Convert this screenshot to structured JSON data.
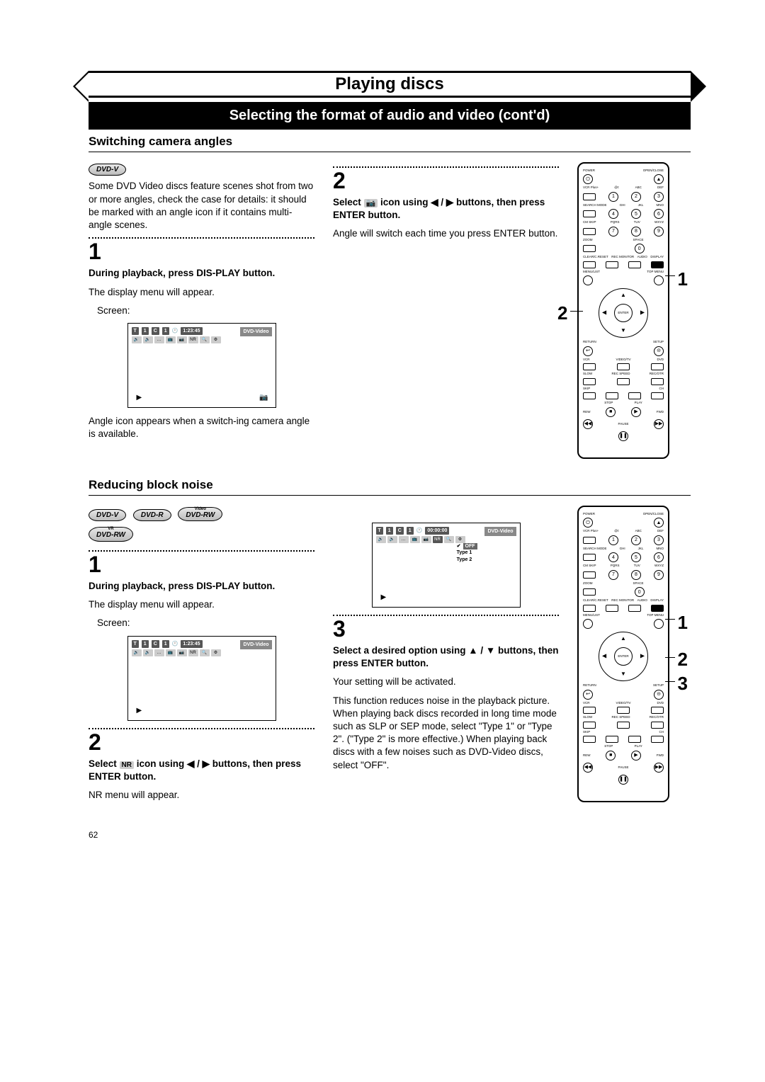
{
  "header": {
    "title": "Playing discs"
  },
  "banner": "Selecting the format of audio and video (cont'd)",
  "section1": {
    "heading": "Switching camera angles",
    "logos": [
      "DVD-V"
    ],
    "intro": "Some DVD Video discs feature scenes shot from two or more angles, check the case for details: it should be marked with an angle icon if it contains multi-angle scenes.",
    "step1": {
      "num": "1",
      "bold": "During playback, press DIS-PLAY button.",
      "text": "The display menu will appear.",
      "screen_label": "Screen:",
      "screen": {
        "t": "T",
        "tval": "1",
        "c": "C",
        "cval": "1",
        "time": "1:23:45",
        "label": "DVD-Video"
      },
      "caption": "Angle icon appears when a switch-ing camera angle is available."
    },
    "step2": {
      "num": "2",
      "bold_pre": "Select ",
      "icon": "📷",
      "bold_post": " icon using ◀ / ▶ buttons, then press ENTER button.",
      "text": "Angle will switch each time you press ENTER button."
    },
    "callouts": [
      "1",
      "2"
    ]
  },
  "section2": {
    "heading": "Reducing block noise",
    "logos": [
      "DVD-V",
      "DVD-R",
      "DVD-RW",
      "DVD-RW"
    ],
    "logos_sub": [
      "",
      "",
      "Video",
      "VR"
    ],
    "step1": {
      "num": "1",
      "bold": "During playback, press DIS-PLAY button.",
      "text": "The display menu will appear.",
      "screen_label": "Screen:",
      "screen": {
        "t": "T",
        "tval": "1",
        "c": "C",
        "cval": "1",
        "time": "1:23:45",
        "label": "DVD-Video"
      }
    },
    "step2": {
      "num": "2",
      "bold_pre": "Select ",
      "icon": "NR",
      "bold_post": " icon using ◀ / ▶ buttons, then press ENTER button.",
      "text": "NR menu will appear.",
      "screen": {
        "t": "T",
        "tval": "1",
        "c": "C",
        "cval": "1",
        "time": "00:00:00",
        "label": "DVD-Video",
        "menu": {
          "off": "OFF",
          "check": "✔",
          "t1": "Type 1",
          "t2": "Type 2"
        }
      }
    },
    "step3": {
      "num": "3",
      "bold": "Select a desired option using ▲ / ▼ buttons, then press ENTER button.",
      "text1": "Your setting will be activated.",
      "text2": "This function reduces noise in the playback picture. When playing back discs recorded in long time mode such as SLP or SEP mode, select \"Type 1\" or \"Type 2\". (\"Type 2\" is more effective.) When playing back discs with a few noises such as DVD-Video discs, select \"OFF\"."
    },
    "callouts": [
      "1",
      "2",
      "3"
    ]
  },
  "remote": {
    "power": "POWER",
    "open": "OPEN/CLOSE",
    "eject": "▲",
    "vcrplus": "VCR Plus+",
    "abc": "ABC",
    "def": "DEF",
    "search": "SEARCH MODE",
    "ghi": "GHI",
    "jkl": "JKL",
    "mno": "MNO",
    "cmskip": "CM SKIP",
    "pqrs": "PQRS",
    "tuv": "TUV",
    "wxyz": "WXYZ",
    "zoom": "ZOOM",
    "space": "SPACE",
    "clear": "CLEAR/C.RESET",
    "recmon": "REC MONITOR",
    "audio": "AUDIO",
    "display": "DISPLAY",
    "menulist": "MENU/LIST",
    "topmenu": "TOP MENU",
    "enter": "ENTER",
    "return": "RETURN",
    "setup": "SETUP",
    "vcr": "VCR",
    "videotv": "VIDEO/TV",
    "dvd": "DVD",
    "slow": "SLOW",
    "recspeed": "REC SPEED",
    "recotr": "REC/OTR",
    "skip": "SKIP",
    "ch": "CH",
    "stop": "STOP",
    "play": "PLAY",
    "rew": "REW",
    "pause": "PAUSE",
    "fwd": "FWD",
    "n1": "1",
    "n2": "2",
    "n3": "3",
    "n4": "4",
    "n5": "5",
    "n6": "6",
    "n7": "7",
    "n8": "8",
    "n9": "9",
    "n0": "0"
  },
  "page": "62"
}
